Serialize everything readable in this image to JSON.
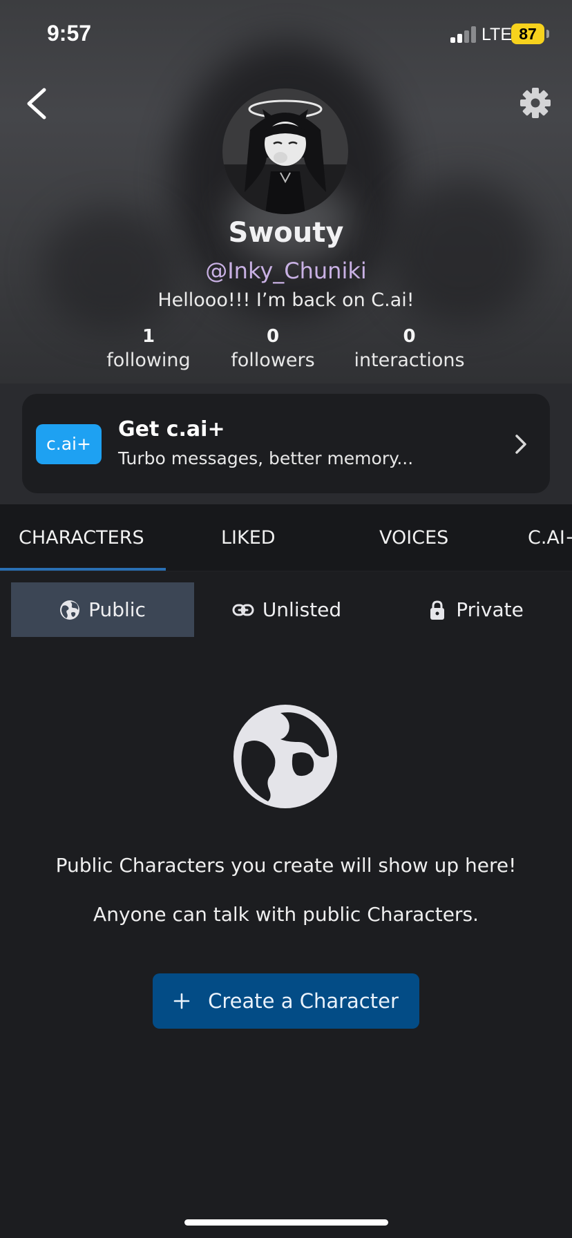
{
  "status_bar": {
    "time": "9:57",
    "network": "LTE",
    "battery": "87"
  },
  "profile": {
    "display_name": "Swouty",
    "username": "@Inky_Chuniki",
    "bio": "Hellooo!!! I’m back on C.ai!",
    "stats": [
      {
        "value": "1",
        "label": "following"
      },
      {
        "value": "0",
        "label": "followers"
      },
      {
        "value": "0",
        "label": "interactions"
      }
    ]
  },
  "promo": {
    "badge": "c.ai+",
    "title": "Get c.ai+",
    "subtitle": "Turbo messages, better memory..."
  },
  "tabs": [
    {
      "label": "CHARACTERS",
      "active": true
    },
    {
      "label": "LIKED",
      "active": false
    },
    {
      "label": "VOICES",
      "active": false
    },
    {
      "label": "C.AI+",
      "active": false
    }
  ],
  "visibility": [
    {
      "label": "Public",
      "icon": "globe-icon",
      "active": true
    },
    {
      "label": "Unlisted",
      "icon": "link-icon",
      "active": false
    },
    {
      "label": "Private",
      "icon": "lock-icon",
      "active": false
    }
  ],
  "empty_state": {
    "icon": "globe-icon",
    "line1": "Public Characters you create will show up here!",
    "line2": "Anyone can talk with public Characters.",
    "button": "Create a Character"
  },
  "colors": {
    "accent_blue": "#1ea1f2",
    "button_blue": "#034c86",
    "tab_underline": "#2a6fb4",
    "handle": "#c9b1e4",
    "battery": "#f7d21d"
  }
}
